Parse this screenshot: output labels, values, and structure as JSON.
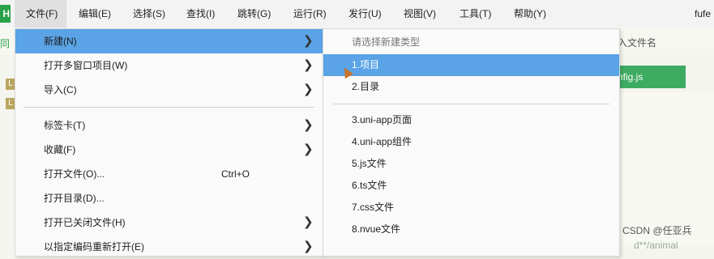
{
  "app": {
    "logo": "H",
    "window_title": "fufe"
  },
  "menubar": {
    "items": [
      {
        "label": "文件(F)"
      },
      {
        "label": "编辑(E)"
      },
      {
        "label": "选择(S)"
      },
      {
        "label": "查找(I)"
      },
      {
        "label": "跳转(G)"
      },
      {
        "label": "运行(R)"
      },
      {
        "label": "发行(U)"
      },
      {
        "label": "视图(V)"
      },
      {
        "label": "工具(T)"
      },
      {
        "label": "帮助(Y)"
      }
    ]
  },
  "toolbar": {
    "left_text": "同",
    "right_text": "入文件名"
  },
  "editor": {
    "markers": [
      "L",
      "L"
    ],
    "tab_label": "nfig.js"
  },
  "file_menu": {
    "items": [
      {
        "label": "新建(N)",
        "shortcut": "",
        "arrow": "❯"
      },
      {
        "label": "打开多窗口项目(W)",
        "shortcut": "",
        "arrow": "❯"
      },
      {
        "label": "导入(C)",
        "shortcut": "",
        "arrow": "❯"
      },
      {
        "label": "标签卡(T)",
        "shortcut": "",
        "arrow": "❯"
      },
      {
        "label": "收藏(F)",
        "shortcut": "",
        "arrow": "❯"
      },
      {
        "label": "打开文件(O)...",
        "shortcut": "Ctrl+O",
        "arrow": ""
      },
      {
        "label": "打开目录(D)...",
        "shortcut": "",
        "arrow": ""
      },
      {
        "label": "打开已关闭文件(H)",
        "shortcut": "",
        "arrow": "❯"
      },
      {
        "label": "以指定编码重新打开(E)",
        "shortcut": "",
        "arrow": "❯"
      }
    ]
  },
  "new_submenu": {
    "header": "请选择新建类型",
    "items": [
      {
        "label": "1.项目"
      },
      {
        "label": "2.目录"
      },
      {
        "label": "3.uni-app页面"
      },
      {
        "label": "4.uni-app组件"
      },
      {
        "label": "5.js文件"
      },
      {
        "label": "6.ts文件"
      },
      {
        "label": "7.css文件"
      },
      {
        "label": "8.nvue文件"
      }
    ]
  },
  "watermark": "CSDN @任亚兵",
  "bottom_text": "d**/animal",
  "colors": {
    "highlight": "#5aa3e6",
    "green": "#3dab62",
    "logo_green": "#2aa24a"
  }
}
